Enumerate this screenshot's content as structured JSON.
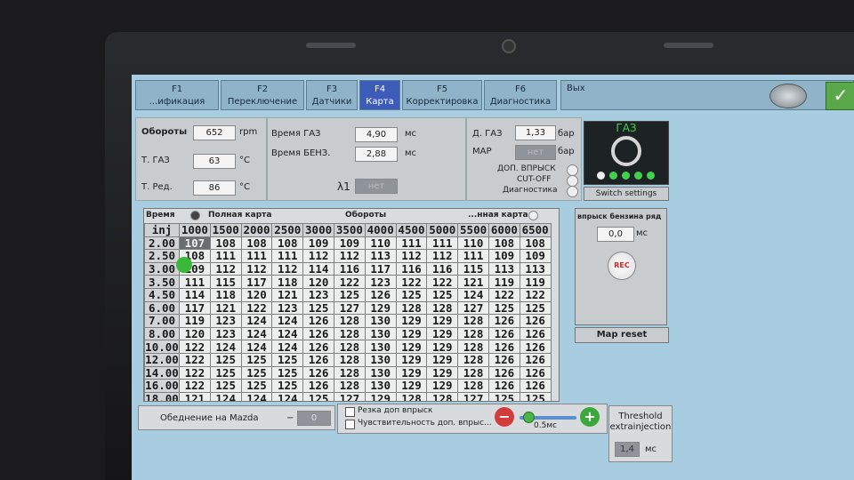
{
  "tabs": [
    {
      "key": "F1",
      "label": "...ификация"
    },
    {
      "key": "F2",
      "label": "Переключение"
    },
    {
      "key": "F3",
      "label": "Датчики"
    },
    {
      "key": "F4",
      "label": "Карта"
    },
    {
      "key": "F5",
      "label": "Корректировка"
    },
    {
      "key": "F6",
      "label": "Диагностика"
    }
  ],
  "exit_label": "Вых",
  "ok_icon": "✓",
  "sensors": {
    "rpm": {
      "label": "Обороты",
      "value": "652",
      "unit": "rpm"
    },
    "t_gas": {
      "label": "Т. ГАЗ",
      "value": "63",
      "unit": "°C"
    },
    "t_red": {
      "label": "Т. Ред.",
      "value": "86",
      "unit": "°C"
    }
  },
  "times": {
    "gas": {
      "label": "Время ГАЗ",
      "value": "4,90",
      "unit": "мс"
    },
    "benz": {
      "label": "Время БЕНЗ.",
      "value": "2,88",
      "unit": "мс"
    },
    "lambda": {
      "label": "λ1",
      "value": "нет"
    }
  },
  "pressure": {
    "gas": {
      "label": "Д. ГАЗ",
      "value": "1,33",
      "unit": "бар"
    },
    "map": {
      "label": "MAP",
      "value": "нет",
      "unit": "бар"
    }
  },
  "status": {
    "extra_inj": "ДОП. ВПРЫСК",
    "cutoff": "CUT-OFF",
    "diag": "Диагностика"
  },
  "gas_widget": {
    "title": "ГАЗ",
    "switch_label": "Switch settings"
  },
  "map": {
    "corner": "Время",
    "corner2": "inj",
    "full_label": "Полная карта",
    "rpm_label": "Обороты",
    "other_label": "...нная карта",
    "columns": [
      "1000",
      "1500",
      "2000",
      "2500",
      "3000",
      "3500",
      "4000",
      "4500",
      "5000",
      "5500",
      "6000",
      "6500"
    ],
    "rows": [
      {
        "h": "2.00",
        "v": [
          "107",
          "108",
          "108",
          "108",
          "109",
          "109",
          "110",
          "111",
          "111",
          "110",
          "108",
          "108"
        ]
      },
      {
        "h": "2.50",
        "v": [
          "108",
          "111",
          "111",
          "111",
          "112",
          "112",
          "113",
          "112",
          "112",
          "111",
          "109",
          "109"
        ]
      },
      {
        "h": "3.00",
        "v": [
          "109",
          "112",
          "112",
          "112",
          "114",
          "116",
          "117",
          "116",
          "116",
          "115",
          "113",
          "113"
        ]
      },
      {
        "h": "3.50",
        "v": [
          "111",
          "115",
          "117",
          "118",
          "120",
          "122",
          "123",
          "122",
          "122",
          "121",
          "119",
          "119"
        ]
      },
      {
        "h": "4.50",
        "v": [
          "114",
          "118",
          "120",
          "121",
          "123",
          "125",
          "126",
          "125",
          "125",
          "124",
          "122",
          "122"
        ]
      },
      {
        "h": "6.00",
        "v": [
          "117",
          "121",
          "122",
          "123",
          "125",
          "127",
          "129",
          "128",
          "128",
          "127",
          "125",
          "125"
        ]
      },
      {
        "h": "7.00",
        "v": [
          "119",
          "123",
          "124",
          "124",
          "126",
          "128",
          "130",
          "129",
          "129",
          "128",
          "126",
          "126"
        ]
      },
      {
        "h": "8.00",
        "v": [
          "120",
          "123",
          "124",
          "124",
          "126",
          "128",
          "130",
          "129",
          "129",
          "128",
          "126",
          "126"
        ]
      },
      {
        "h": "10.00",
        "v": [
          "122",
          "124",
          "124",
          "124",
          "126",
          "128",
          "130",
          "129",
          "129",
          "128",
          "126",
          "126"
        ]
      },
      {
        "h": "12.00",
        "v": [
          "122",
          "125",
          "125",
          "125",
          "126",
          "128",
          "130",
          "129",
          "129",
          "128",
          "126",
          "126"
        ]
      },
      {
        "h": "14.00",
        "v": [
          "122",
          "125",
          "125",
          "125",
          "126",
          "128",
          "130",
          "129",
          "129",
          "128",
          "126",
          "126"
        ]
      },
      {
        "h": "16.00",
        "v": [
          "122",
          "125",
          "125",
          "125",
          "126",
          "128",
          "130",
          "129",
          "129",
          "128",
          "126",
          "126"
        ]
      },
      {
        "h": "18.00",
        "v": [
          "121",
          "124",
          "124",
          "124",
          "125",
          "127",
          "129",
          "128",
          "128",
          "127",
          "125",
          "125"
        ]
      }
    ]
  },
  "injection": {
    "title": "впрыск бензина ряд",
    "value": "0,0",
    "unit": "мс",
    "rec_label": "REC"
  },
  "map_reset": "Map reset",
  "lean": {
    "label": "Обеднение на Mazda",
    "sign": "−",
    "value": "0"
  },
  "options": {
    "cut_extra": "Резка доп впрыск",
    "sensitivity": "Чувствительность доп. впрыс...",
    "slider_value": "0.5мс",
    "minus": "−",
    "plus": "+"
  },
  "threshold": {
    "title1": "Threshold",
    "title2": "extrainjection",
    "value": "1,4",
    "unit": "мс"
  }
}
